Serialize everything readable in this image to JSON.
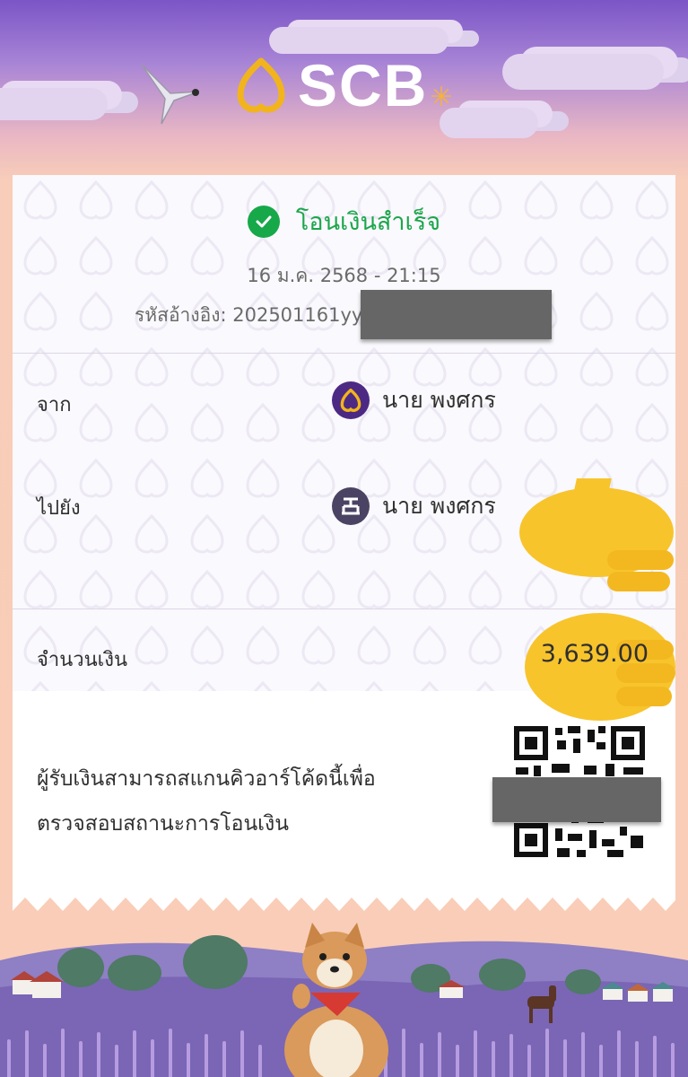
{
  "brand": {
    "name": "SCB"
  },
  "status": {
    "text": "โอนเงินสำเร็จ",
    "icon": "check-circle-icon",
    "color": "#1ba64b"
  },
  "datetime": "16 ม.ค. 2568 - 21:15",
  "reference": {
    "label": "รหัสอ้างอิง:",
    "value": "202501161yy"
  },
  "sender": {
    "label": "จาก",
    "name": "นาย พงศกร",
    "bank_icon": "scb-bank-icon"
  },
  "receiver": {
    "label": "ไปยัง",
    "name": "นาย พงศกร",
    "bank_icon": "gsb-bank-icon"
  },
  "amount": {
    "label": "จำนวนเงิน",
    "value": "3,639.00"
  },
  "qr_note": {
    "line1": "ผู้รับเงินสามารถสแกนคิวอาร์โค้ดนี้เพื่อ",
    "line2": "ตรวจสอบสถานะการโอนเงิน"
  },
  "colors": {
    "brand_purple": "#4c2a83",
    "success_green": "#17a84a",
    "peach_bg": "#f9cdb8"
  }
}
